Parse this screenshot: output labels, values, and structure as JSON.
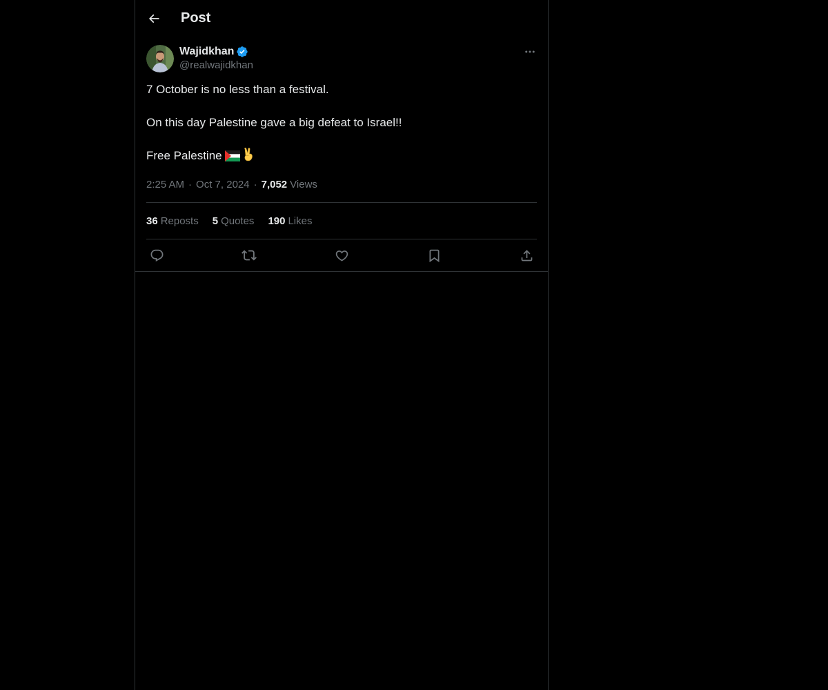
{
  "header": {
    "back_icon": "arrow-left-icon",
    "title": "Post"
  },
  "post": {
    "author": {
      "name": "Wajidkhan",
      "handle": "@realwajidkhan",
      "verified": true,
      "verified_color": "#1d9bf0"
    },
    "text": {
      "line1": "7 October is no less than a festival.",
      "line2": "On this day Palestine gave a big defeat to Israel!!",
      "line3": "Free Palestine"
    },
    "emojis": [
      "palestine-flag-icon",
      "victory-hand-icon"
    ],
    "time": "2:25 AM",
    "date": "Oct 7, 2024",
    "views_count": "7,052",
    "views_label": "Views",
    "separator": "·"
  },
  "stats": {
    "reposts_count": "36",
    "reposts_label": "Reposts",
    "quotes_count": "5",
    "quotes_label": "Quotes",
    "likes_count": "190",
    "likes_label": "Likes"
  },
  "actions": [
    "reply-icon",
    "repost-icon",
    "like-icon",
    "bookmark-icon",
    "share-icon"
  ],
  "colors": {
    "background": "#000000",
    "text_primary": "#e7e9ea",
    "text_secondary": "#71767b",
    "border": "#2f3336",
    "accent": "#1d9bf0"
  }
}
